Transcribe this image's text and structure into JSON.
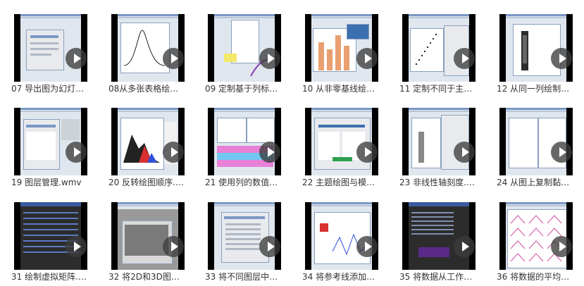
{
  "videos": [
    {
      "title": "07 导出图为幻灯…",
      "scene": "dialog"
    },
    {
      "title": "08从多张表格绘…",
      "scene": "peak"
    },
    {
      "title": "09 定制基于列标…",
      "scene": "legend"
    },
    {
      "title": "10 从非零基线绘…",
      "scene": "bars"
    },
    {
      "title": "11 定制不同于主…",
      "scene": "scatter"
    },
    {
      "title": "12 从同一列绘制…",
      "scene": "columns"
    },
    {
      "title": "19 图层管理.wmv",
      "scene": "layers"
    },
    {
      "title": "20 反转绘图顺序.…",
      "scene": "colorpeaks"
    },
    {
      "title": "21 使用列的数值…",
      "scene": "sheet"
    },
    {
      "title": "22 主题绘图与模…",
      "scene": "theme"
    },
    {
      "title": "23 非线性轴刻度.…",
      "scene": "axis"
    },
    {
      "title": "24 从图上复制黏…",
      "scene": "copy"
    },
    {
      "title": "31 绘制虚拟矩阵.…",
      "scene": "matrix"
    },
    {
      "title": "32 将2D和3D图…",
      "scene": "gray"
    },
    {
      "title": "33 将不同图层中…",
      "scene": "dialog2"
    },
    {
      "title": "34 将参考线添加…",
      "scene": "refline"
    },
    {
      "title": "35 将数据从工作…",
      "scene": "worksheet"
    },
    {
      "title": "36 将数据的平均…",
      "scene": "mean"
    }
  ],
  "icons": {
    "play": "play-icon"
  }
}
